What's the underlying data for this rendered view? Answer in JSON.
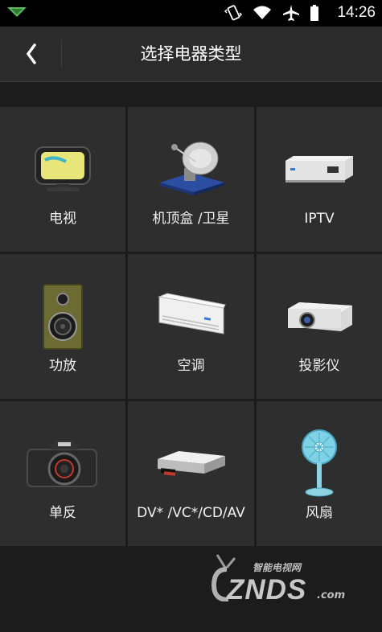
{
  "status_bar": {
    "time": "14:26"
  },
  "header": {
    "title": "选择电器类型"
  },
  "devices": [
    {
      "label": "电视",
      "icon": "tv-icon"
    },
    {
      "label": "机顶盒 /卫星",
      "icon": "satellite-dish-icon"
    },
    {
      "label": "IPTV",
      "icon": "iptv-box-icon"
    },
    {
      "label": "功放",
      "icon": "speaker-icon"
    },
    {
      "label": "空调",
      "icon": "air-conditioner-icon"
    },
    {
      "label": "投影仪",
      "icon": "projector-icon"
    },
    {
      "label": "单反",
      "icon": "camera-icon"
    },
    {
      "label": "DV* /VC*/CD/AV",
      "icon": "dvd-player-icon"
    },
    {
      "label": "风扇",
      "icon": "fan-icon"
    }
  ],
  "watermark": {
    "sub": "智能电视网",
    "main": "ZNDS",
    "suffix": ".com"
  }
}
